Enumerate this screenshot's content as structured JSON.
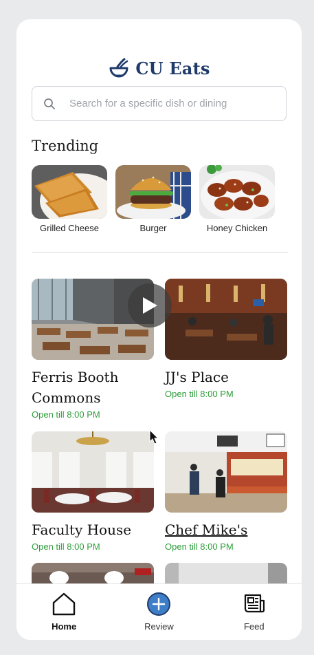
{
  "app": {
    "title": "CU Eats"
  },
  "search": {
    "placeholder": "Search for a specific dish or dining"
  },
  "trending": {
    "title": "Trending",
    "items": [
      {
        "label": "Grilled Cheese"
      },
      {
        "label": "Burger"
      },
      {
        "label": "Honey Chicken"
      }
    ]
  },
  "dining": [
    {
      "name_line1": "Ferris Booth",
      "name_line2": "Commons",
      "status": "Open till 8:00 PM"
    },
    {
      "name_line1": "JJ's Place",
      "status": "Open till 8:00 PM"
    },
    {
      "name_line1": "Faculty House",
      "status": "Open till 8:00 PM"
    },
    {
      "name_line1": "Chef Mike's",
      "status": "Open till 8:00 PM"
    }
  ],
  "nav": {
    "home": "Home",
    "review": "Review",
    "feed": "Feed"
  },
  "colors": {
    "brand": "#1f3b6b",
    "open_status": "#2e9d3a",
    "review_button": "#3e7ec8"
  }
}
